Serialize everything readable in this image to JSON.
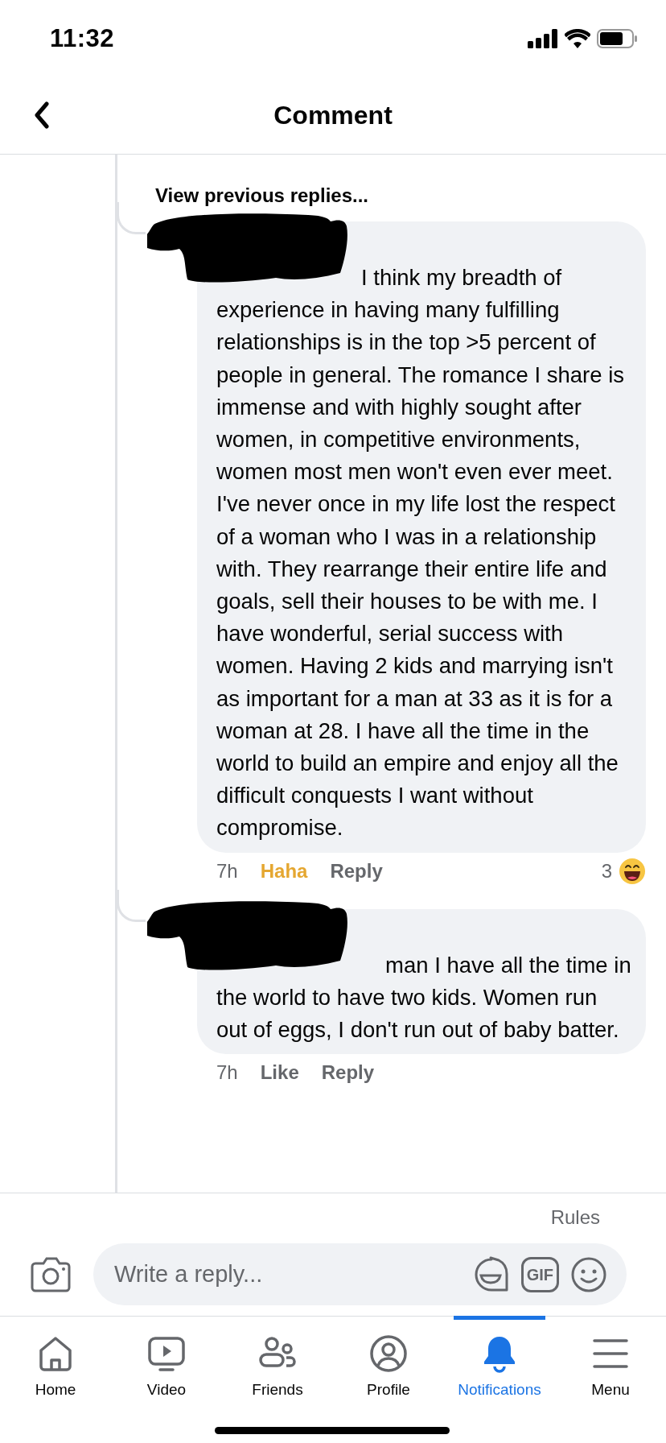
{
  "status_bar": {
    "time": "11:32"
  },
  "header": {
    "title": "Comment"
  },
  "thread": {
    "view_previous": "View previous replies...",
    "comments": [
      {
        "text": "I think my breadth of experience in having many fulfilling relationships is in the top >5 percent of people in general. The romance I share is immense and with highly sought after women, in competitive environments, women most men won't even ever meet. I've never once in my life lost the respect of a woman who I was in a relationship with. They rearrange their entire life and goals, sell their houses to be with me. I have wonderful, serial success with women. Having 2 kids and marrying isn't as important for a man at 33 as it is for a woman at 28. I have all the time in the world to build an empire and enjoy all the difficult conquests I want without compromise.",
        "time": "7h",
        "react_button": {
          "label": "Haha",
          "reacted": true
        },
        "reply": "Reply",
        "reactions": {
          "count": "3",
          "kind": "haha"
        }
      },
      {
        "text": "man I have all the time in the world to have two kids. Women run out of eggs, I don't run out of baby batter.",
        "time": "7h",
        "react_button": {
          "label": "Like",
          "reacted": false
        },
        "reply": "Reply"
      }
    ]
  },
  "composer": {
    "rules": "Rules",
    "placeholder": "Write a reply...",
    "gif_label": "GIF"
  },
  "tab_bar": [
    {
      "label": "Home",
      "kind": "home",
      "selected": false
    },
    {
      "label": "Video",
      "kind": "video",
      "selected": false
    },
    {
      "label": "Friends",
      "kind": "friends",
      "selected": false
    },
    {
      "label": "Profile",
      "kind": "profile",
      "selected": false
    },
    {
      "label": "Notifications",
      "kind": "bell",
      "selected": true
    },
    {
      "label": "Menu",
      "kind": "menu",
      "selected": false
    }
  ]
}
